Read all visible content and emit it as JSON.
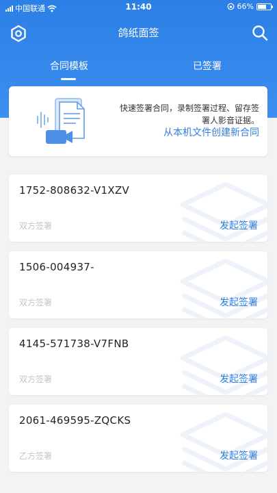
{
  "status_bar": {
    "carrier": "中国联通",
    "time": "11:40",
    "battery": "66%",
    "battery_level": 0.66
  },
  "nav": {
    "title": "鸽纸面签",
    "left_icon": "settings-icon",
    "right_icon": "search-icon"
  },
  "tabs": [
    {
      "label": "合同模板",
      "active": true
    },
    {
      "label": "已签署",
      "active": false
    }
  ],
  "banner": {
    "description": "快速签署合同，录制签署过程、留存签署人影音证据。",
    "link": "从本机文件创建新合同"
  },
  "contracts": [
    {
      "code": "1752-808632-V1XZV",
      "type": "双方签署",
      "action": "发起签署"
    },
    {
      "code": "1506-004937-",
      "type": "双方签署",
      "action": "发起签署"
    },
    {
      "code": "4145-571738-V7FNB",
      "type": "双方签署",
      "action": "发起签署"
    },
    {
      "code": "2061-469595-ZQCKS",
      "type": "乙方签署",
      "action": "发起签署"
    }
  ],
  "colors": {
    "primary": "#2f7fe0",
    "header_top": "#2b7fe6",
    "background": "#f2f3f5"
  }
}
